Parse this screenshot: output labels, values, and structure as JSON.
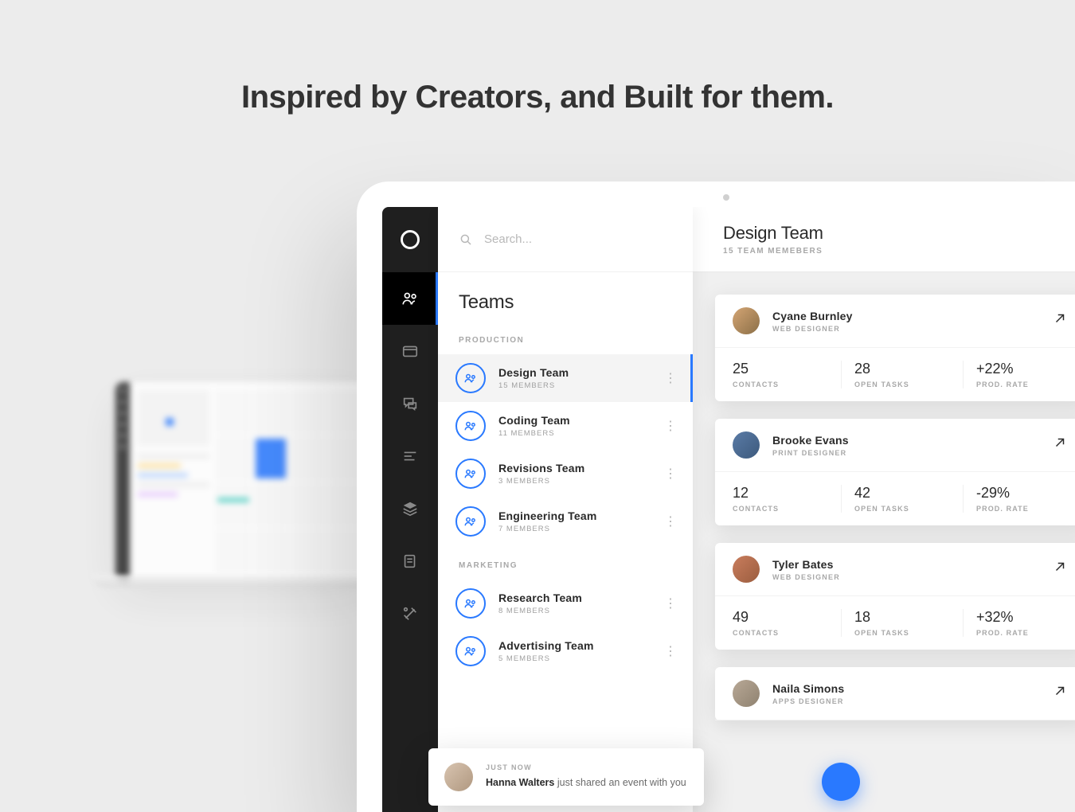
{
  "headline": "Inspired by Creators, and Built for them.",
  "search": {
    "placeholder": "Search..."
  },
  "panel": {
    "title": "Teams"
  },
  "sections": {
    "production": {
      "label": "PRODUCTION"
    },
    "marketing": {
      "label": "MARKETING"
    }
  },
  "teams": {
    "production": [
      {
        "name": "Design Team",
        "members": "15 MEMBERS"
      },
      {
        "name": "Coding Team",
        "members": "11 MEMBERS"
      },
      {
        "name": "Revisions Team",
        "members": "3 MEMBERS"
      },
      {
        "name": "Engineering Team",
        "members": "7 MEMBERS"
      }
    ],
    "marketing": [
      {
        "name": "Research Team",
        "members": "8 MEMBERS"
      },
      {
        "name": "Advertising Team",
        "members": "5 MEMBERS"
      }
    ]
  },
  "main": {
    "title": "Design Team",
    "subtitle": "15 TEAM MEMEBERS"
  },
  "stat_labels": {
    "contacts": "CONTACTS",
    "open_tasks": "OPEN TASKS",
    "prod_rate": "PROD. RATE"
  },
  "members": [
    {
      "name": "Cyane Burnley",
      "role": "WEB DESIGNER",
      "contacts": "25",
      "open_tasks": "28",
      "prod_rate": "+22%"
    },
    {
      "name": "Brooke Evans",
      "role": "PRINT DESIGNER",
      "contacts": "12",
      "open_tasks": "42",
      "prod_rate": "-29%"
    },
    {
      "name": "Tyler Bates",
      "role": "WEB DESIGNER",
      "contacts": "49",
      "open_tasks": "18",
      "prod_rate": "+32%"
    },
    {
      "name": "Naila Simons",
      "role": "APPS DESIGNER",
      "contacts": "",
      "open_tasks": "",
      "prod_rate": ""
    }
  ],
  "toast": {
    "time": "JUST NOW",
    "actor": "Hanna Walters",
    "action": " just shared an event with you"
  }
}
